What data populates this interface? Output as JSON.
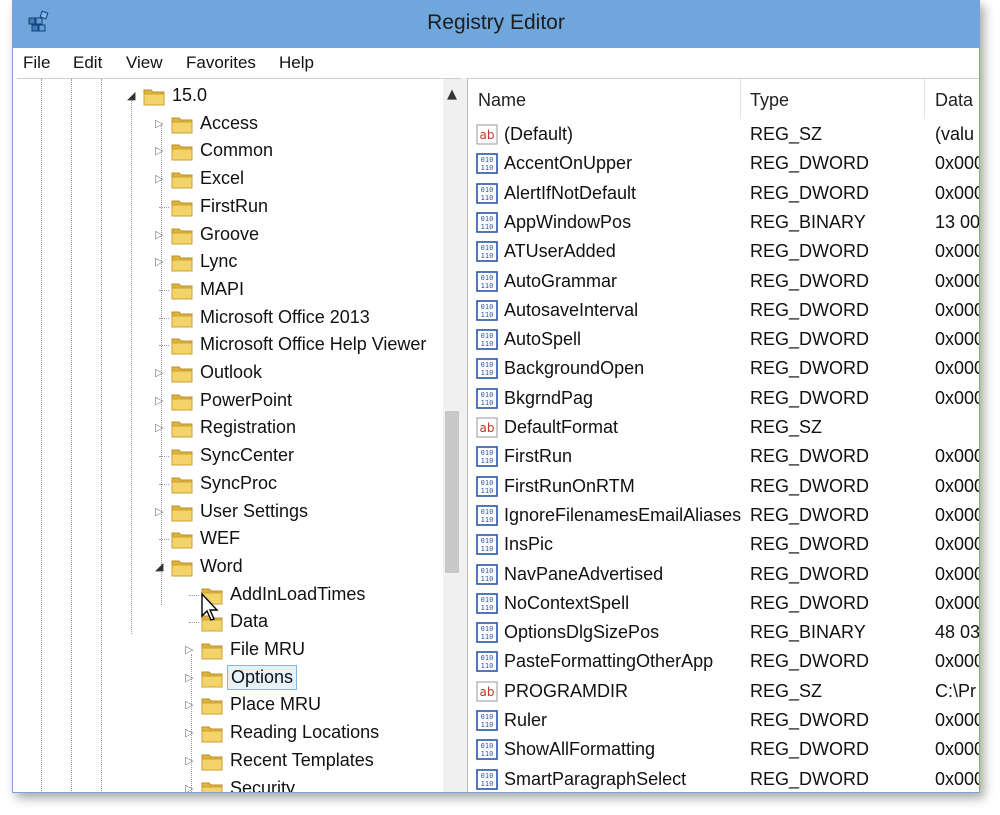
{
  "window": {
    "title": "Registry Editor"
  },
  "menu": [
    "File",
    "Edit",
    "View",
    "Favorites",
    "Help"
  ],
  "tree": {
    "parent": "15.0",
    "children": [
      "Access",
      "Common",
      "Excel",
      "FirstRun",
      "Groove",
      "Lync",
      "MAPI",
      "Microsoft Office 2013",
      "Microsoft Office Help Viewer",
      "Outlook",
      "PowerPoint",
      "Registration",
      "SyncCenter",
      "SyncProc",
      "User Settings",
      "WEF",
      "Word"
    ],
    "word_children": [
      "AddInLoadTimes",
      "Data",
      "File MRU",
      "Options",
      "Place MRU",
      "Reading Locations",
      "Recent Templates",
      "Security"
    ],
    "selected": "Options"
  },
  "columns": {
    "name": "Name",
    "type": "Type",
    "data": "Data"
  },
  "values": [
    {
      "name": "(Default)",
      "type": "REG_SZ",
      "data": "(valu",
      "icon": "string-value-icon"
    },
    {
      "name": "AccentOnUpper",
      "type": "REG_DWORD",
      "data": "0x000",
      "icon": "binary-value-icon"
    },
    {
      "name": "AlertIfNotDefault",
      "type": "REG_DWORD",
      "data": "0x000",
      "icon": "binary-value-icon"
    },
    {
      "name": "AppWindowPos",
      "type": "REG_BINARY",
      "data": "13 00",
      "icon": "binary-value-icon"
    },
    {
      "name": "ATUserAdded",
      "type": "REG_DWORD",
      "data": "0x000",
      "icon": "binary-value-icon"
    },
    {
      "name": "AutoGrammar",
      "type": "REG_DWORD",
      "data": "0x000",
      "icon": "binary-value-icon"
    },
    {
      "name": "AutosaveInterval",
      "type": "REG_DWORD",
      "data": "0x000",
      "icon": "binary-value-icon"
    },
    {
      "name": "AutoSpell",
      "type": "REG_DWORD",
      "data": "0x000",
      "icon": "binary-value-icon"
    },
    {
      "name": "BackgroundOpen",
      "type": "REG_DWORD",
      "data": "0x000",
      "icon": "binary-value-icon"
    },
    {
      "name": "BkgrndPag",
      "type": "REG_DWORD",
      "data": "0x000",
      "icon": "binary-value-icon"
    },
    {
      "name": "DefaultFormat",
      "type": "REG_SZ",
      "data": "",
      "icon": "string-value-icon"
    },
    {
      "name": "FirstRun",
      "type": "REG_DWORD",
      "data": "0x000",
      "icon": "binary-value-icon"
    },
    {
      "name": "FirstRunOnRTM",
      "type": "REG_DWORD",
      "data": "0x000",
      "icon": "binary-value-icon"
    },
    {
      "name": "IgnoreFilenamesEmailAliases",
      "type": "REG_DWORD",
      "data": "0x000",
      "icon": "binary-value-icon"
    },
    {
      "name": "InsPic",
      "type": "REG_DWORD",
      "data": "0x000",
      "icon": "binary-value-icon"
    },
    {
      "name": "NavPaneAdvertised",
      "type": "REG_DWORD",
      "data": "0x000",
      "icon": "binary-value-icon"
    },
    {
      "name": "NoContextSpell",
      "type": "REG_DWORD",
      "data": "0x000",
      "icon": "binary-value-icon"
    },
    {
      "name": "OptionsDlgSizePos",
      "type": "REG_BINARY",
      "data": "48 03",
      "icon": "binary-value-icon"
    },
    {
      "name": "PasteFormattingOtherApp",
      "type": "REG_DWORD",
      "data": "0x000",
      "icon": "binary-value-icon"
    },
    {
      "name": "PROGRAMDIR",
      "type": "REG_SZ",
      "data": "C:\\Pr",
      "icon": "string-value-icon"
    },
    {
      "name": "Ruler",
      "type": "REG_DWORD",
      "data": "0x000",
      "icon": "binary-value-icon"
    },
    {
      "name": "ShowAllFormatting",
      "type": "REG_DWORD",
      "data": "0x000",
      "icon": "binary-value-icon"
    },
    {
      "name": "SmartParagraphSelect",
      "type": "REG_DWORD",
      "data": "0x000",
      "icon": "binary-value-icon"
    }
  ],
  "colors": {
    "titlebar": "#6fa6db",
    "selection_bg": "#e5f1fb",
    "selection_border": "#7db7e6",
    "folder": "#e8c04a"
  }
}
